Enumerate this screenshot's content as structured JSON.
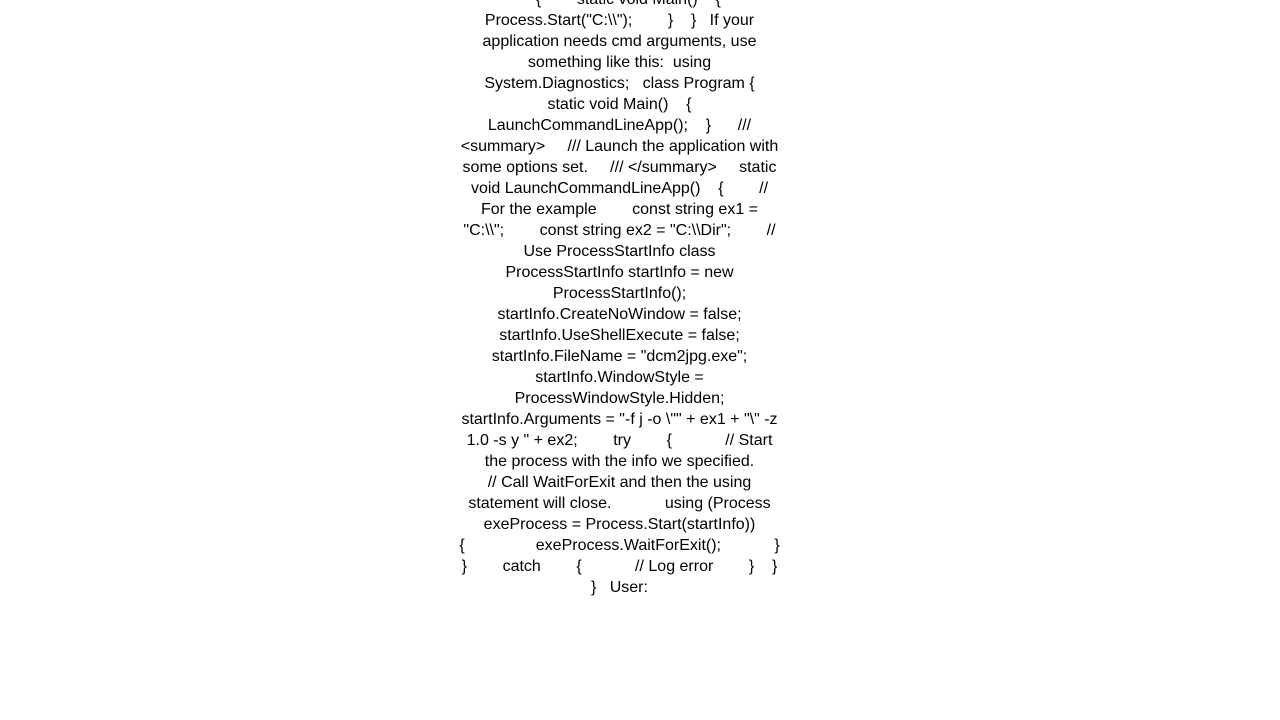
{
  "page": {
    "background_color": "#ffffff",
    "text_color": "#000000",
    "snippet": {
      "language": "csharp",
      "body": "    {        static void Main()    {            Process.Start(\"C:\\\\\");        }    }   If your application needs cmd arguments, use something like this:  using System.Diagnostics;   class Program {    static void Main()    {        LaunchCommandLineApp();    }      /// <summary>     /// Launch the application with some options set.     /// </summary>     static void LaunchCommandLineApp()    {        // For the example        const string ex1 = \"C:\\\\\";        const string ex2 = \"C:\\\\Dir\";        // Use ProcessStartInfo class        ProcessStartInfo startInfo = new ProcessStartInfo();        startInfo.CreateNoWindow = false;        startInfo.UseShellExecute = false;        startInfo.FileName = \"dcm2jpg.exe\";        startInfo.WindowStyle = ProcessWindowStyle.Hidden;        startInfo.Arguments = \"-f j -o \\\"\" + ex1 + \"\\\" -z 1.0 -s y \" + ex2;        try        {            // Start the process with the info we specified.            // Call WaitForExit and then the using statement will close.            using (Process exeProcess = Process.Start(startInfo))            {                exeProcess.WaitForExit();            }        }        catch        {            // Log error        }    }  }   User:"
    }
  }
}
